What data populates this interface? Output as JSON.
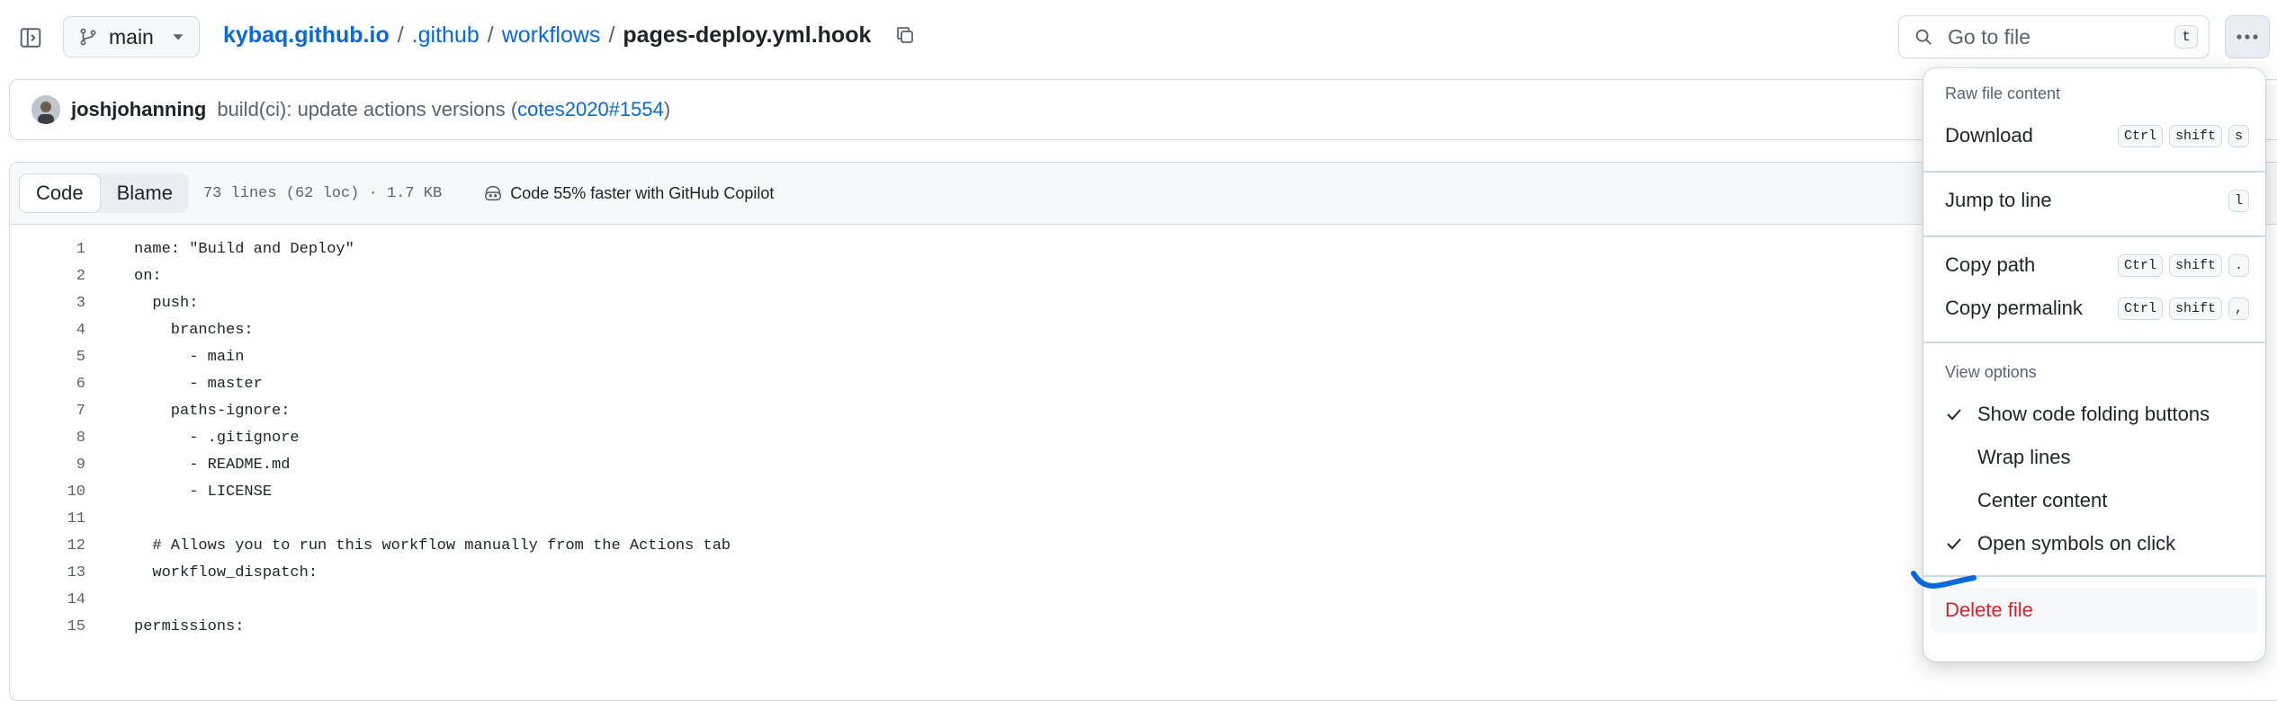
{
  "header": {
    "branch": "main",
    "breadcrumb": {
      "repo": "kybaq.github.io",
      "sep": "/",
      "dir1": ".github",
      "dir2": "workflows",
      "file": "pages-deploy.yml.hook"
    },
    "search": {
      "placeholder": "Go to file",
      "shortcut": "t"
    }
  },
  "commit": {
    "author": "joshjohanning",
    "message": "build(ci): update actions versions (",
    "link": "cotes2020#1554",
    "close": ")"
  },
  "file": {
    "tabs": {
      "code": "Code",
      "blame": "Blame"
    },
    "stats": "73 lines (62 loc) · 1.7 KB",
    "copilot": "Code 55% faster with GitHub Copilot",
    "lines": [
      {
        "n": "1",
        "text": "name: \"Build and Deploy\""
      },
      {
        "n": "2",
        "text": "on:"
      },
      {
        "n": "3",
        "text": "  push:"
      },
      {
        "n": "4",
        "text": "    branches:"
      },
      {
        "n": "5",
        "text": "      - main"
      },
      {
        "n": "6",
        "text": "      - master"
      },
      {
        "n": "7",
        "text": "    paths-ignore:"
      },
      {
        "n": "8",
        "text": "      - .gitignore"
      },
      {
        "n": "9",
        "text": "      - README.md"
      },
      {
        "n": "10",
        "text": "      - LICENSE"
      },
      {
        "n": "11",
        "text": ""
      },
      {
        "n": "12",
        "text": "  # Allows you to run this workflow manually from the Actions tab"
      },
      {
        "n": "13",
        "text": "  workflow_dispatch:"
      },
      {
        "n": "14",
        "text": ""
      },
      {
        "n": "15",
        "text": "permissions:"
      }
    ]
  },
  "menu": {
    "raw_title": "Raw file content",
    "download": {
      "label": "Download",
      "keys": [
        "Ctrl",
        "shift",
        "s"
      ]
    },
    "jump": {
      "label": "Jump to line",
      "keys": [
        "l"
      ]
    },
    "copy_path": {
      "label": "Copy path",
      "keys": [
        "Ctrl",
        "shift",
        "."
      ]
    },
    "copy_permalink": {
      "label": "Copy permalink",
      "keys": [
        "Ctrl",
        "shift",
        ","
      ]
    },
    "view_title": "View options",
    "folding": "Show code folding buttons",
    "wrap": "Wrap lines",
    "center": "Center content",
    "symbols": "Open symbols on click",
    "delete": "Delete file"
  },
  "colors": {
    "link": "#0969da",
    "danger": "#d1242f",
    "border": "#d1d9e0",
    "annotation": "#0969da"
  },
  "icons": [
    "sidebar-expand-icon",
    "git-branch-icon",
    "chevron-down-icon",
    "copy-icon",
    "search-icon",
    "kebab-horizontal-icon",
    "copilot-icon",
    "check-icon"
  ]
}
